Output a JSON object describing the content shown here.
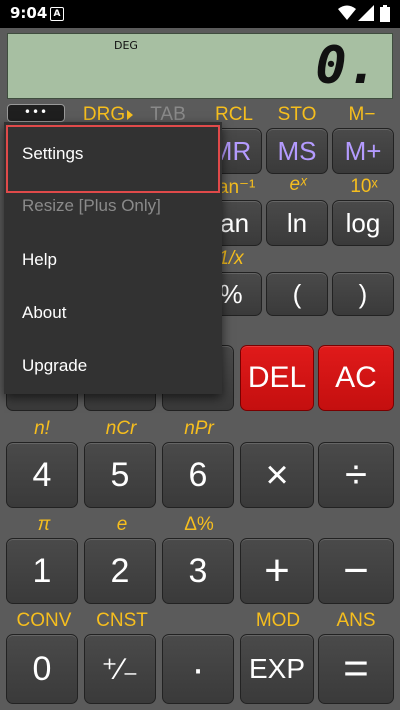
{
  "status": {
    "time": "9:04",
    "notif_icon": "A"
  },
  "display": {
    "mode": "DEG",
    "value": "0."
  },
  "menu_button": "•••",
  "row1_labels": {
    "drg": "DRG",
    "tab": "TAB",
    "rcl": "RCL",
    "sto": "STO",
    "mminus": "M−"
  },
  "row1_keys": {
    "mr": "MR",
    "ms": "MS",
    "mplus": "M+"
  },
  "row2_labels": {
    "tan_inv": "tan⁻¹",
    "ex": "eˣ",
    "tenx": "10ˣ"
  },
  "row2_keys": {
    "tan": "tan",
    "ln": "ln",
    "log": "log"
  },
  "row3_labels": {
    "inv": "1/x"
  },
  "row3_keys": {
    "percent": "%",
    "lparen": "(",
    "rparen": ")"
  },
  "row4_keys": {
    "del": "DEL",
    "ac": "AC"
  },
  "row5_labels": {
    "fact": "n!",
    "ncr": "nCr",
    "npr": "nPr"
  },
  "row5_keys": {
    "four": "4",
    "five": "5",
    "six": "6",
    "times": "×",
    "divide": "÷"
  },
  "row6_labels": {
    "pi": "π",
    "e": "e",
    "delta": "Δ%"
  },
  "row6_keys": {
    "one": "1",
    "two": "2",
    "three": "3",
    "plus": "+",
    "minus": "−"
  },
  "row7_labels": {
    "conv": "CONV",
    "cnst": "CNST",
    "mod": "MOD",
    "ans": "ANS"
  },
  "row7_keys": {
    "zero": "0",
    "plusminus": "⁺∕₋",
    "dot": "·",
    "exp": "EXP",
    "equals": "="
  },
  "popup": {
    "items": [
      "Settings",
      "Resize [Plus Only]",
      "Help",
      "About",
      "Upgrade"
    ]
  },
  "colors": {
    "accent": "#f6be1e",
    "red": "#d31414",
    "purple": "#b49bff",
    "display": "#a7bfa2"
  }
}
